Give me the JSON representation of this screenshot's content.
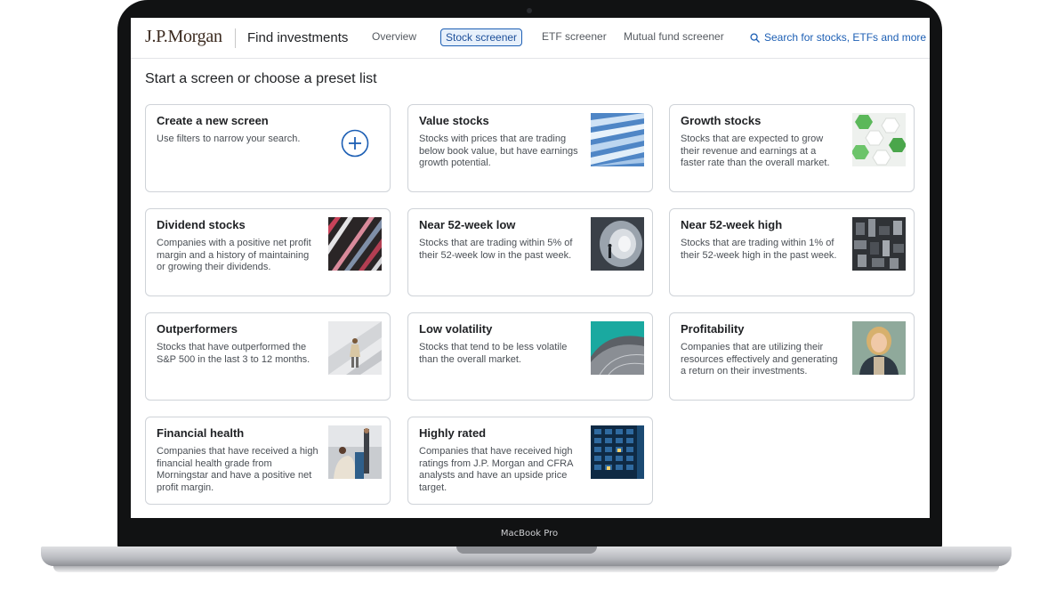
{
  "device": {
    "label": "MacBook Pro"
  },
  "header": {
    "logo": "J.P.Morgan",
    "title": "Find investments",
    "nav": [
      {
        "label": "Overview",
        "active": false
      },
      {
        "label": "Stock screener",
        "active": true
      },
      {
        "label": "ETF screener",
        "active": false
      },
      {
        "label": "Mutual fund screener",
        "active": false
      }
    ],
    "search_label": "Search for stocks, ETFs and more"
  },
  "page_title": "Start a screen or choose a preset list",
  "cards": [
    {
      "title": "Create a new screen",
      "desc": "Use filters to narrow your search.",
      "icon": "plus-circle-icon"
    },
    {
      "title": "Value stocks",
      "desc": "Stocks with prices that are trading below book value, but have earnings growth potential.",
      "image": "blue-glass-building"
    },
    {
      "title": "Growth stocks",
      "desc": "Stocks that are expected to grow their revenue and earnings at a faster rate than the overall market.",
      "image": "green-hexagons"
    },
    {
      "title": "Dividend stocks",
      "desc": "Companies with a positive net profit margin and a history of maintaining or growing their dividends.",
      "image": "colorful-facade"
    },
    {
      "title": "Near 52-week low",
      "desc": "Stocks that are trading within 5% of their 52-week low in the past week.",
      "image": "tunnel-walker"
    },
    {
      "title": "Near 52-week high",
      "desc": "Stocks that are trading within 1% of their 52-week high in the past week.",
      "image": "city-aerial"
    },
    {
      "title": "Outperformers",
      "desc": "Stocks that have outperformed the S&P 500 in the last 3 to 12 months.",
      "image": "woman-walking"
    },
    {
      "title": "Low volatility",
      "desc": "Stocks that tend to be less volatile than the overall market.",
      "image": "teal-curved-building"
    },
    {
      "title": "Profitability",
      "desc": "Companies that are utilizing their resources effectively and generating a return on their investments.",
      "image": "smiling-woman"
    },
    {
      "title": "Financial health",
      "desc": "Companies that have received a high financial health grade from Morningstar and have a positive net profit margin.",
      "image": "office-meeting"
    },
    {
      "title": "Highly rated",
      "desc": "Companies that have received high ratings from J.P. Morgan and CFRA analysts and have an upside price target.",
      "image": "night-skyscraper"
    }
  ],
  "colors": {
    "accent": "#1d5fb4",
    "text": "#1f2124",
    "border": "#cfd3d8"
  }
}
